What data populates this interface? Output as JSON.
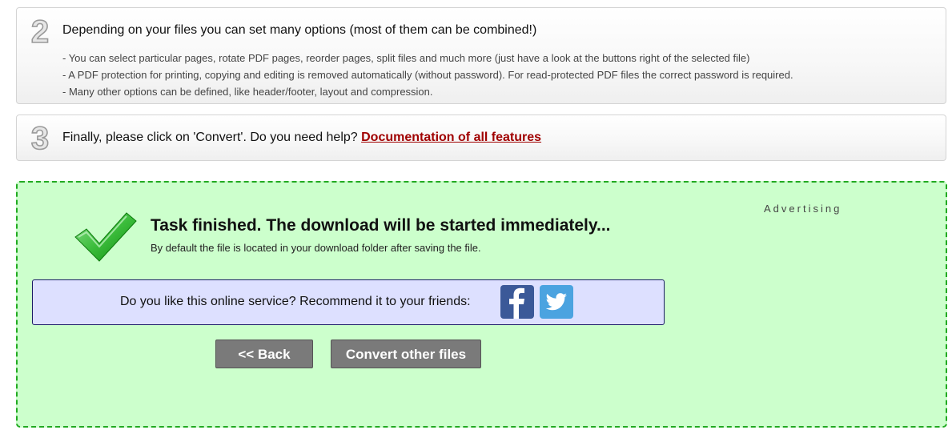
{
  "steps": {
    "step2": {
      "number": "2",
      "title": "Depending on your files you can set many options (most of them can be combined!)",
      "lines": [
        "- You can select particular pages, rotate PDF pages, reorder pages, split files and much more (just have a look at the buttons right of the selected file)",
        "- A PDF protection for printing, copying and editing is removed automatically (without password). For read-protected PDF files the correct password is required.",
        "- Many other options can be defined, like header/footer, layout and compression."
      ]
    },
    "step3": {
      "number": "3",
      "title_prefix": "Finally, please click on 'Convert'. Do you need help? ",
      "link_label": "Documentation of all features"
    }
  },
  "result": {
    "title": "Task finished. The download will be started immediately...",
    "subtitle": "By default the file is located in your download folder after saving the file.",
    "advertising_label": "Advertising",
    "recommend_text": "Do you like this online service? Recommend it to your friends:",
    "social": {
      "facebook_icon": "facebook-icon",
      "twitter_icon": "twitter-icon"
    },
    "buttons": {
      "back_label": "<< Back",
      "convert_label": "Convert other files"
    }
  },
  "colors": {
    "success_bg": "#ccffcc",
    "success_border": "#22aa22",
    "recommend_bg": "#dde0ff",
    "link": "#a00000",
    "button_bg": "#7a7a7a",
    "facebook": "#3b5998",
    "twitter": "#4ba3e0"
  }
}
